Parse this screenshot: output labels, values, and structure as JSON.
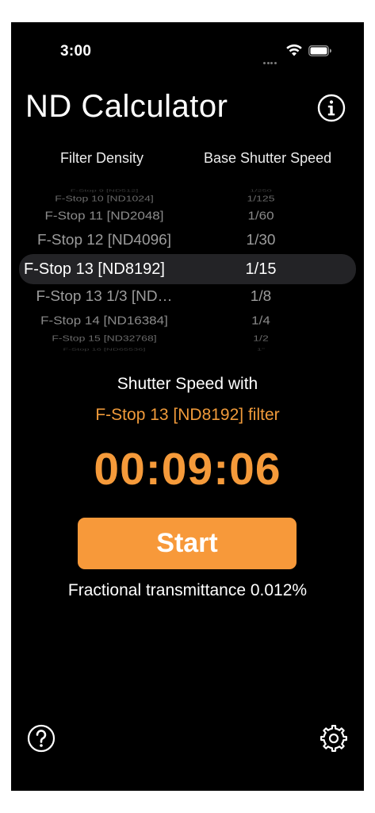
{
  "status_bar": {
    "time": "3:00"
  },
  "header": {
    "title": "ND Calculator",
    "info_icon": "info-circle-icon"
  },
  "columns": {
    "left": "Filter Density",
    "right": "Base Shutter Speed"
  },
  "picker": {
    "rows": [
      {
        "filter": "F-Stop 9 [ND512]",
        "speed": "1/250"
      },
      {
        "filter": "F-Stop 10 [ND1024]",
        "speed": "1/125"
      },
      {
        "filter": "F-Stop 11 [ND2048]",
        "speed": "1/60"
      },
      {
        "filter": "F-Stop 12 [ND4096]",
        "speed": "1/30"
      },
      {
        "filter": "F-Stop 13 [ND8192]",
        "speed": "1/15"
      },
      {
        "filter": "F-Stop 13 1/3 [ND…",
        "speed": "1/8"
      },
      {
        "filter": "F-Stop 14 [ND16384]",
        "speed": "1/4"
      },
      {
        "filter": "F-Stop 15 [ND32768]",
        "speed": "1/2"
      },
      {
        "filter": "F-Stop 16 [ND65536]",
        "speed": "1\""
      }
    ],
    "selected_index": 4
  },
  "result": {
    "label": "Shutter Speed with",
    "filter_label": "F-Stop 13 [ND8192] filter",
    "timer": "00:09:06",
    "start_label": "Start",
    "transmittance": "Fractional transmittance 0.012%"
  },
  "footer": {
    "help_icon": "question-circle-icon",
    "settings_icon": "gear-icon"
  },
  "colors": {
    "background": "#000000",
    "accent": "#f7993a",
    "accent_text": "#f09a3a",
    "selection": "#232326"
  }
}
